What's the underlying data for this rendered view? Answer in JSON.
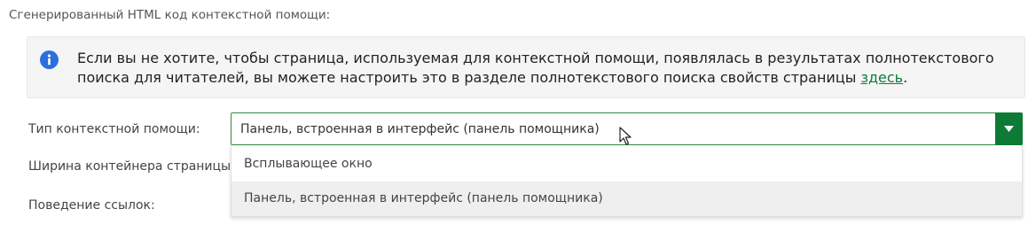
{
  "section_title": "Сгенерированный HTML код контекстной помощи:",
  "info": {
    "text_before": "Если вы не хотите, чтобы страница, используемая для контекстной помощи, появлялась в результатах полнотекстового поиска для читателей, вы можете настроить это в разделе полнотекстового поиска свойств страницы ",
    "link": "здесь",
    "text_after": ".",
    "icon": "info-circle-icon",
    "icon_color": "#2c6fdc"
  },
  "form": {
    "help_type_label": "Тип контекстной помощи:",
    "width_label": "Ширина контейнера страницы:",
    "links_label": "Поведение ссылок:",
    "help_type_value": "Панель, встроенная в интерфейс (панель помощника)",
    "accent_color": "#0d7a35"
  },
  "dropdown": {
    "options": [
      "Всплывающее окно",
      "Панель, встроенная в интерфейс (панель помощника)"
    ],
    "highlighted_index": 1
  }
}
